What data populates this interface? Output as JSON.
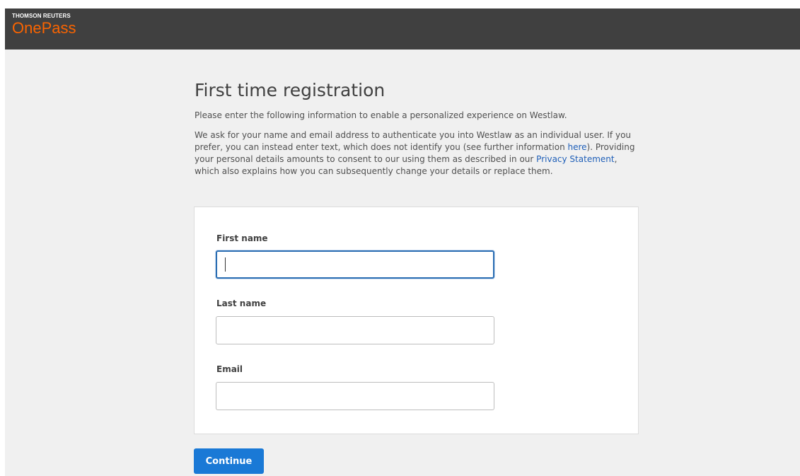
{
  "header": {
    "brand_small": "THOMSON REUTERS",
    "brand_product": "OnePass"
  },
  "page": {
    "title": "First time registration",
    "intro": "Please enter the following information to enable a personalized experience on Westlaw.",
    "consent": {
      "part1": "We ask for your name and email address to authenticate you into Westlaw as an individual user. If you prefer, you can instead enter text, which does not identify you (see further information ",
      "link_here": "here",
      "part2": "). Providing your personal details amounts to consent to our using them as described in our ",
      "link_privacy": "Privacy Statement",
      "part3": ", which also explains how you can subsequently change your details or replace them."
    }
  },
  "form": {
    "first_name_label": "First name",
    "first_name_value": "",
    "last_name_label": "Last name",
    "last_name_value": "",
    "email_label": "Email",
    "email_value": "",
    "continue_label": "Continue"
  },
  "colors": {
    "topbar": "#404040",
    "brand_orange": "#fa6400",
    "link": "#1f5fb8",
    "primary_button": "#1a79d6",
    "focus_border": "#2a6db2"
  }
}
